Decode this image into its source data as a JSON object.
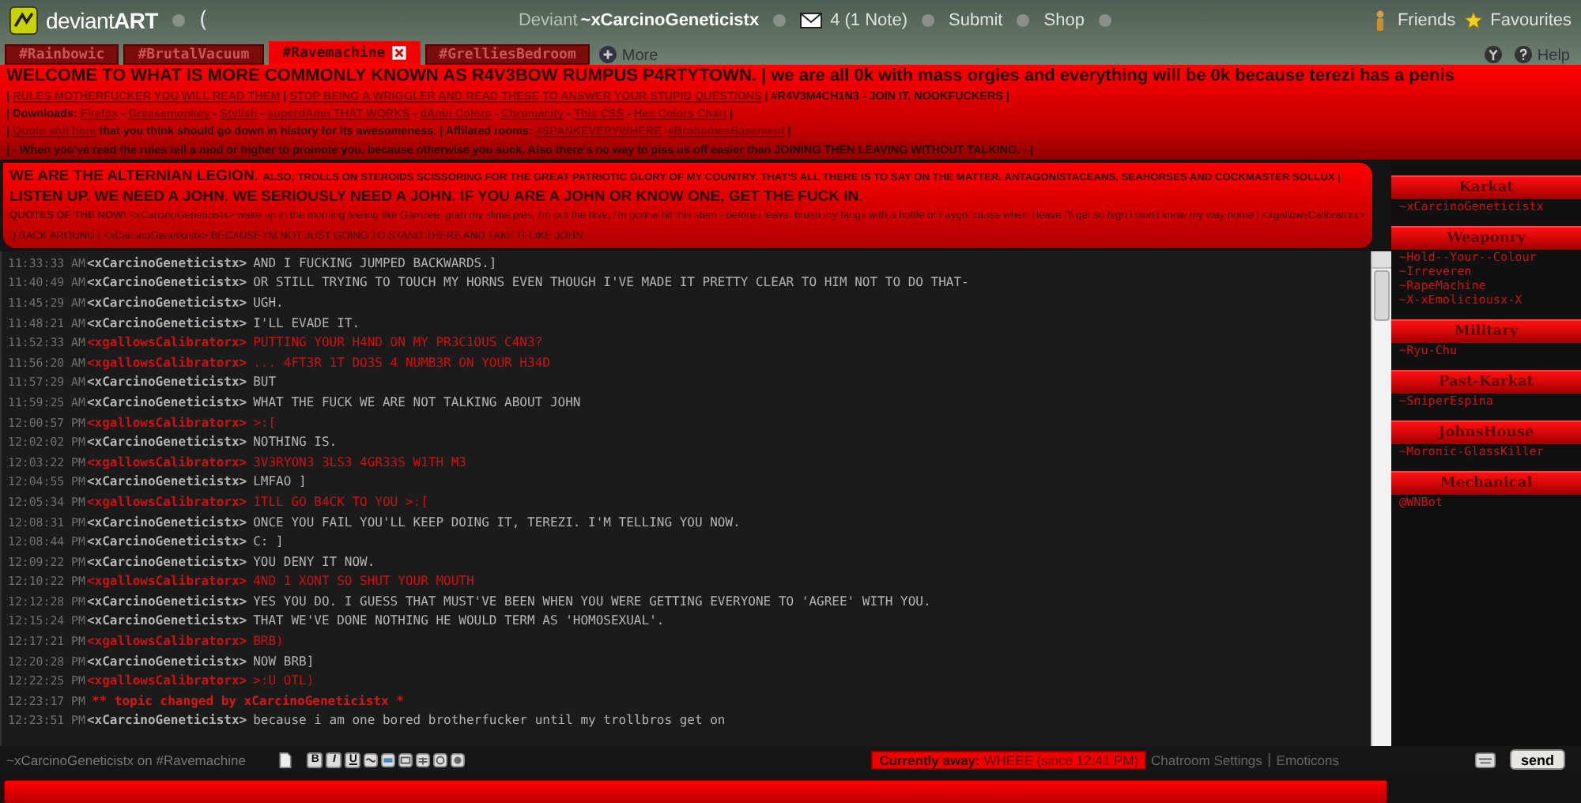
{
  "topbar": {
    "logo": "deviant**ART**",
    "bracket": "(",
    "deviant_label": "Deviant",
    "username": "~xCarcinoGeneticistx",
    "notes": "4 (1 Note)",
    "submit": "Submit",
    "shop": "Shop",
    "friends": "Friends",
    "favourites": "Favourites",
    "help": "Help"
  },
  "tabs": [
    {
      "label": "#Rainbowic",
      "selected": false
    },
    {
      "label": "#BrutalVacuum",
      "selected": false
    },
    {
      "label": "#Ravemachine",
      "selected": true
    },
    {
      "label": "#GrelliesBedroom",
      "selected": false
    }
  ],
  "more": "More",
  "header": [
    {
      "kind": "title",
      "segments": [
        {
          "kind": "plain",
          "text": "WELCOME TO WHAT IS MORE COMMONLY KNOWN AS R4V3BOW RUMPUS P4RTYTOWN. | we are all 0k with mass orgies and everything will be 0k because terezi has a penis"
        }
      ]
    },
    {
      "kind": "info",
      "segments": [
        {
          "kind": "plain",
          "text": "| "
        },
        {
          "kind": "link",
          "text": "RULES MOTHERFUCKER YOU WILL READ THEM"
        },
        {
          "kind": "plain",
          "text": " | "
        },
        {
          "kind": "link",
          "text": "STOP BEING A WRIGGLER AND READ THESE TO ANSWER YOUR STUPID QUESTIONS"
        },
        {
          "kind": "plain",
          "text": " | #R4V3M4CH1N3 - JOIN IT, NOOKFUCKERS |"
        }
      ]
    },
    {
      "kind": "info",
      "segments": [
        {
          "kind": "plain",
          "text": "| Downloads: "
        },
        {
          "kind": "link",
          "text": "Firefox"
        },
        {
          "kind": "plain",
          "text": " - "
        },
        {
          "kind": "link",
          "text": "Greasemonkey"
        },
        {
          "kind": "plain",
          "text": " - "
        },
        {
          "kind": "link",
          "text": "Stylish"
        },
        {
          "kind": "plain",
          "text": " - "
        },
        {
          "kind": "link",
          "text": "superdAmn THAT WORKS"
        },
        {
          "kind": "plain",
          "text": " - "
        },
        {
          "kind": "link",
          "text": "dAmn Colors"
        },
        {
          "kind": "plain",
          "text": " - "
        },
        {
          "kind": "link",
          "text": "Chromacity"
        },
        {
          "kind": "plain",
          "text": " - "
        },
        {
          "kind": "link",
          "text": "This CSS"
        },
        {
          "kind": "plain",
          "text": " - "
        },
        {
          "kind": "link",
          "text": "Hex Colors Chart"
        },
        {
          "kind": "plain",
          "text": " |"
        }
      ]
    },
    {
      "kind": "info",
      "segments": [
        {
          "kind": "plain",
          "text": "| "
        },
        {
          "kind": "link",
          "text": "Quote shit here"
        },
        {
          "kind": "plain",
          "text": " that you think should go down in history for its awesomeness. | Affilated rooms: "
        },
        {
          "kind": "link",
          "text": "#SPANKEVERYWHERE"
        },
        {
          "kind": "link",
          "text": "#BrohomesBasement"
        },
        {
          "kind": "plain",
          "text": " |"
        }
      ]
    },
    {
      "kind": "info",
      "segments": [
        {
          "kind": "plain",
          "text": "| - When you've read the rules tell a mod or higher to promote you, because otherwise you suck. Also there's no way to piss us off easier than JOINING THEN LEAVING WITHOUT TALKING. - |"
        }
      ]
    }
  ],
  "topic": [
    {
      "segments": [
        {
          "kind": "large",
          "text": "WE ARE THE ALTERNIAN LEGION. "
        },
        {
          "kind": "small",
          "text": "ALSO, TROLLS ON STEROIDS SCISSORING FOR THE GREAT PATRIOTIC GLORY OF MY COUNTRY. THAT'S ALL THERE IS TO SAY ON THE MATTER. ANTAGONISTACEANS, SEAHORSES AND COCKMASTER SOLLUX | "
        },
        {
          "kind": "large",
          "text": "LISTEN UP. WE NEED A JOHN. WE SERIOUSLY NEED A JOHN. IF YOU ARE A JOHN OR KNOW ONE, GET THE FUCK IN."
        }
      ]
    },
    {
      "segments": [
        {
          "kind": "label",
          "text": "QUOTES OF THE NOW! "
        },
        {
          "kind": "quote",
          "text": "<xCarcinoGeneticistx> wake up in the morning feeling like Gamzee, grab my slime pies, i'm out the hive, i'm gonna hit this stem - before i leave, brush my fangs with a bottle of Faygo 'cause when i leave i'll get so high i won't know my way home | <xgallowsCalibratorx> ;) BACK AROUND | <xCarcinoGeneticistx> BECAUSE I'M NOT JUST GOING TO STAND THERE AND TAKE IT LIKE JOHN"
        }
      ]
    }
  ],
  "messages": [
    {
      "kind": "message",
      "time": "11:33:33 AM",
      "user": "<xCarcinoGeneticistx>",
      "text": "AND I FUCKING JUMPED BACKWARDS.]",
      "color": "#b4b4b4"
    },
    {
      "kind": "message",
      "time": "11:40:49 AM",
      "user": "<xCarcinoGeneticistx>",
      "text": "OR STILL TRYING TO TOUCH MY HORNS EVEN THOUGH I'VE MADE IT PRETTY CLEAR TO HIM NOT TO DO THAT-",
      "color": "#b4b4b4"
    },
    {
      "kind": "message",
      "time": "11:45:29 AM",
      "user": "<xCarcinoGeneticistx>",
      "text": "UGH.",
      "color": "#b4b4b4"
    },
    {
      "kind": "message",
      "time": "11:48:21 AM",
      "user": "<xCarcinoGeneticistx>",
      "text": "I'LL EVADE IT.",
      "color": "#b4b4b4"
    },
    {
      "kind": "message",
      "time": "11:52:33 AM",
      "user": "<xgallowsCalibratorx>",
      "text": "PUTTING YOUR H4ND ON MY PR3C1OUS C4N3?",
      "color": "#d01010"
    },
    {
      "kind": "message",
      "time": "11:56:20 AM",
      "user": "<xgallowsCalibratorx>",
      "text": "... 4FT3R 1T DO3S 4 NUMB3R ON YOUR H34D",
      "color": "#d01010"
    },
    {
      "kind": "message",
      "time": "11:57:29 AM",
      "user": "<xCarcinoGeneticistx>",
      "text": "BUT",
      "color": "#b4b4b4"
    },
    {
      "kind": "message",
      "time": "11:59:25 AM",
      "user": "<xCarcinoGeneticistx>",
      "text": "WHAT THE FUCK WE ARE NOT TALKING ABOUT JOHN",
      "color": "#b4b4b4"
    },
    {
      "kind": "message",
      "time": "12:00:57 PM",
      "user": "<xgallowsCalibratorx>",
      "text": ">:[",
      "color": "#d01010"
    },
    {
      "kind": "message",
      "time": "12:02:02 PM",
      "user": "<xCarcinoGeneticistx>",
      "text": "NOTHING IS.",
      "color": "#b4b4b4"
    },
    {
      "kind": "message",
      "time": "12:03:22 PM",
      "user": "<xgallowsCalibratorx>",
      "text": "3V3RYON3 3LS3 4GR33S W1TH M3",
      "color": "#d01010"
    },
    {
      "kind": "message",
      "time": "12:04:55 PM",
      "user": "<xCarcinoGeneticistx>",
      "text": "LMFAO ]",
      "color": "#b4b4b4"
    },
    {
      "kind": "message",
      "time": "12:05:34 PM",
      "user": "<xgallowsCalibratorx>",
      "text": "1TLL GO B4CK TO YOU >:[",
      "color": "#d01010"
    },
    {
      "kind": "message",
      "time": "12:08:31 PM",
      "user": "<xCarcinoGeneticistx>",
      "text": "ONCE YOU FAIL YOU'LL KEEP DOING IT, TEREZI. I'M TELLING YOU NOW.",
      "color": "#b4b4b4"
    },
    {
      "kind": "message",
      "time": "12:08:44 PM",
      "user": "<xCarcinoGeneticistx>",
      "text": "C: ]",
      "color": "#b4b4b4"
    },
    {
      "kind": "message",
      "time": "12:09:22 PM",
      "user": "<xCarcinoGeneticistx>",
      "text": "YOU DENY IT NOW.",
      "color": "#b4b4b4"
    },
    {
      "kind": "message",
      "time": "12:10:22 PM",
      "user": "<xgallowsCalibratorx>",
      "text": "4ND 1 XONT SO SHUT YOUR MOUTH",
      "color": "#d01010"
    },
    {
      "kind": "message",
      "time": "12:12:28 PM",
      "user": "<xCarcinoGeneticistx>",
      "text": "YES YOU DO. I GUESS THAT MUST'VE BEEN WHEN YOU WERE GETTING EVERYONE TO 'AGREE' WITH YOU.",
      "color": "#b4b4b4"
    },
    {
      "kind": "message",
      "time": "12:15:24 PM",
      "user": "<xCarcinoGeneticistx>",
      "text": "THAT WE'VE DONE NOTHING HE WOULD TERM AS 'HOMOSEXUAL'.",
      "color": "#b4b4b4"
    },
    {
      "kind": "message",
      "time": "12:17:21 PM",
      "user": "<xgallowsCalibratorx>",
      "text": "BRB)",
      "color": "#d01010"
    },
    {
      "kind": "message",
      "time": "12:20:28 PM",
      "user": "<xCarcinoGeneticistx>",
      "text": "NOW BRB]",
      "color": "#b4b4b4"
    },
    {
      "kind": "message",
      "time": "12:22:25 PM",
      "user": "<xgallowsCalibratorx>",
      "text": ">:U OTL)",
      "color": "#d01010"
    },
    {
      "kind": "event",
      "time": "12:23:17 PM",
      "text": "** topic changed by xCarcinoGeneticistx *",
      "color": "#e01414"
    },
    {
      "kind": "message",
      "time": "12:23:51 PM",
      "user": "<xCarcinoGeneticistx>",
      "text": "because i am one bored brotherfucker until my trollbros get on",
      "color": "#b4b4b4"
    }
  ],
  "members": [
    {
      "group": "Karkat",
      "users": [
        "~xCarcinoGeneticistx"
      ]
    },
    {
      "group": "Weaponry",
      "users": [
        "~Hold--Your--Colour",
        "~Irreveren",
        "~RapeMachine",
        "~X-xEmoliciousx-X"
      ]
    },
    {
      "group": "Military",
      "users": [
        "~Ryu-Chu"
      ]
    },
    {
      "group": "Past-Karkat",
      "users": [
        "~SniperEspina"
      ]
    },
    {
      "group": "JohnsHouse",
      "users": [
        "~Moronic-GlassKiller"
      ]
    },
    {
      "group": "Mechanical",
      "users": [
        "@WNBot"
      ]
    }
  ],
  "footer": {
    "status": "~xCarcinoGeneticistx on #Ravemachine",
    "format_buttons": [
      "B",
      "I",
      "U"
    ],
    "away_label": "Currently away:",
    "away_text": "WHEEE (since 12:41 PM)",
    "settings": "Chatroom Settings",
    "separator": "|",
    "emoticons": "Emoticons",
    "send": "send"
  }
}
